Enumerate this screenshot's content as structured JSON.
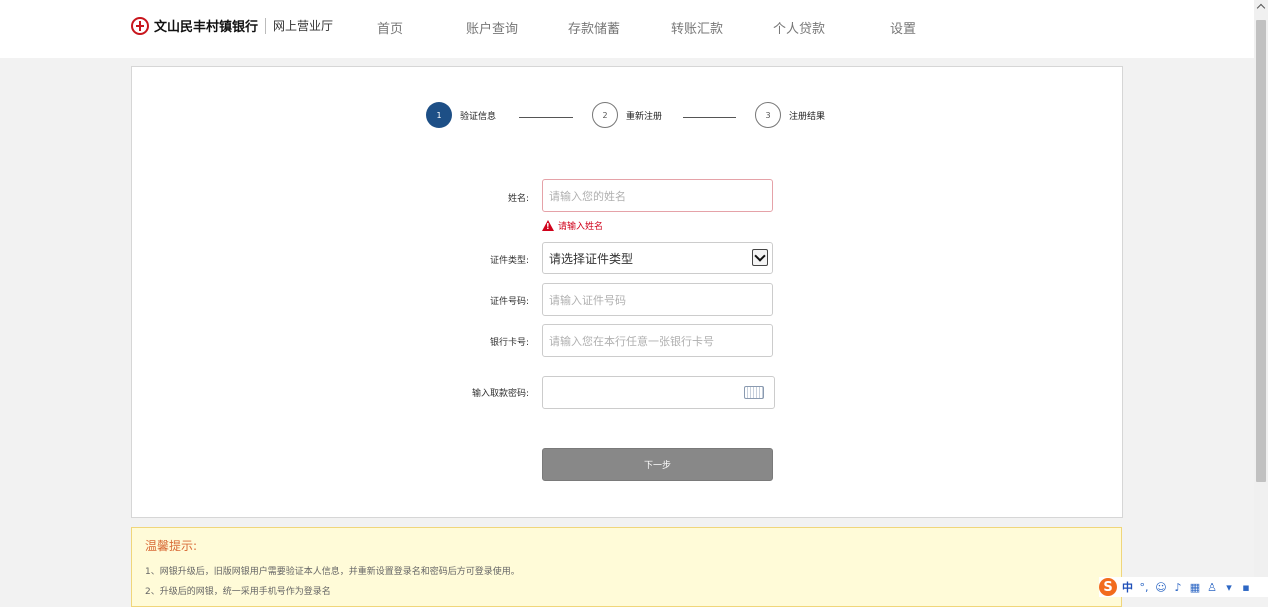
{
  "header": {
    "bank_name": "文山民丰村镇银行",
    "portal_name": "网上营业厅",
    "nav": [
      "首页",
      "账户查询",
      "存款储蓄",
      "转账汇款",
      "个人贷款",
      "设置"
    ]
  },
  "steps": [
    {
      "number": "1",
      "label": "验证信息",
      "active": true
    },
    {
      "number": "2",
      "label": "重新注册",
      "active": false
    },
    {
      "number": "3",
      "label": "注册结果",
      "active": false
    }
  ],
  "form": {
    "name_label": "姓名:",
    "name_placeholder": "请输入您的姓名",
    "name_error": "请输入姓名",
    "id_type_label": "证件类型:",
    "id_type_value": "请选择证件类型",
    "id_number_label": "证件号码:",
    "id_number_placeholder": "请输入证件号码",
    "card_label": "银行卡号:",
    "card_placeholder": "请输入您在本行任意一张银行卡号",
    "password_label": "输入取款密码:",
    "next_button": "下一步"
  },
  "tips": {
    "title": "温馨提示:",
    "lines": [
      "1、网银升级后，旧版网银用户需要验证本人信息，并重新设置登录名和密码后方可登录使用。",
      "2、升级后的网银，统一采用手机号作为登录名"
    ]
  },
  "ime": {
    "mode": "中",
    "punct": "°,"
  },
  "colors": {
    "accent": "#1d4f86",
    "error": "#d0021b",
    "brand": "#c8161d",
    "tips_title": "#d86a36"
  }
}
